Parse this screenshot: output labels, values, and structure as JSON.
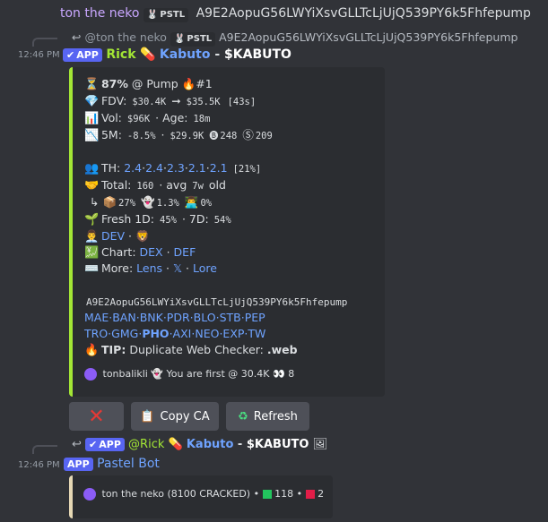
{
  "top_message": {
    "author": "ton the neko",
    "tag": "PSTL",
    "content": "A9E2AopuG56LWYiXsvGLLTcLjUjQ539PY6k5Fhfepump"
  },
  "message1": {
    "reply": {
      "mention": "@ton the neko",
      "tag": "PSTL",
      "content": "A9E2AopuG56LWYiXsvGLLTcLjUjQ539PY6k5Fhfepump"
    },
    "time": "12:46 PM",
    "app_badge": "APP",
    "author": "Rick",
    "title_link": "Kabuto",
    "title_sep": " - ",
    "title_ticker": "$KABUTO",
    "embed": {
      "line1": {
        "pct": "87%",
        "mid": "@ Pump",
        "rank": "#1"
      },
      "line2": {
        "label": "FDV:",
        "from": "$30.4K",
        "to": "$35.5K",
        "dur": "[43s]"
      },
      "line3": {
        "label": "Vol:",
        "vol": "$96K",
        "age_label": "Age:",
        "age": "18m"
      },
      "line4": {
        "label": "5M:",
        "pct": "-8.5%",
        "price": "$29.9K",
        "buys": "248",
        "sells": "209"
      },
      "line5": {
        "label": "TH:",
        "holders": [
          "2.4",
          "2.4",
          "2.3",
          "2.1",
          "2.1"
        ],
        "total": "[21%]"
      },
      "line6": {
        "label": "Total:",
        "total": "160",
        "avg_label": "avg",
        "avg": "7w",
        "old": "old"
      },
      "line7": {
        "a": "27%",
        "b": "1.3%",
        "c": "0%"
      },
      "line8": {
        "label": "Fresh 1D:",
        "d1": "45%",
        "d7_label": "7D:",
        "d7": "54%"
      },
      "line9": {
        "dev": "DEV"
      },
      "line10": {
        "label": "Chart:",
        "a": "DEX",
        "b": "DEF"
      },
      "line11": {
        "label": "More:",
        "a": "Lens",
        "b": "𝕏",
        "c": "Lore"
      },
      "ca": "A9E2AopuG56LWYiXsvGLLTcLjUjQ539PY6k5Fhfepump",
      "links1": [
        "MAE",
        "BAN",
        "BNK",
        "PDR",
        "BLO",
        "STB",
        "PEP"
      ],
      "links2": [
        "TRO",
        "GMG",
        "PHO",
        "AXI",
        "NEO",
        "EXP",
        "TW"
      ],
      "tip_label": "TIP:",
      "tip_text": "Duplicate Web Checker:",
      "tip_cmd": ".web",
      "footer": {
        "user": "tonbalikli",
        "text": "You are first @ 30.4K",
        "count": "8"
      }
    },
    "buttons": {
      "copy": "Copy CA",
      "refresh": "Refresh"
    }
  },
  "message2": {
    "reply": {
      "app_badge": "APP",
      "mention": "@Rick",
      "link": "Kabuto",
      "sep": " - ",
      "ticker": "$KABUTO"
    },
    "time": "12:46 PM",
    "app_badge": "APP",
    "author": "Pastel Bot",
    "embed": {
      "user": "ton the neko (8100 CRACKED)",
      "green": "118",
      "red": "2"
    }
  },
  "colors": {
    "accent_green": "#a3e635",
    "app_blue": "#5865f2",
    "link": "#6fa3ff"
  }
}
